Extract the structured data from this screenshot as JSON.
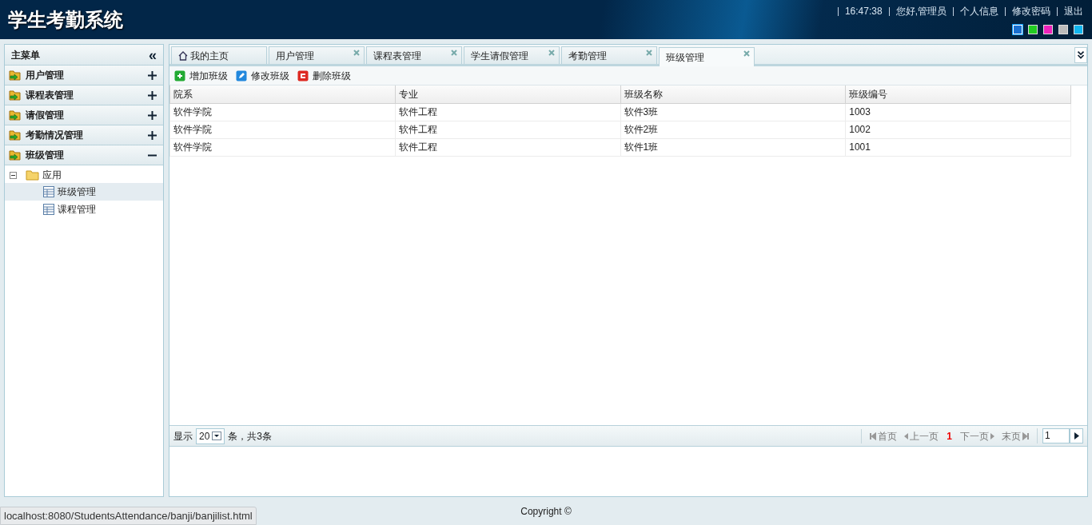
{
  "header": {
    "title": "学生考勤系统",
    "links": [
      "16:47:38",
      "您好,管理员",
      "个人信息",
      "修改密码",
      "退出"
    ],
    "themes": [
      {
        "color": "#1a6fd0",
        "selected": true
      },
      {
        "color": "#22cc22",
        "selected": false
      },
      {
        "color": "#ee22bb",
        "selected": false
      },
      {
        "color": "#bbbbbb",
        "selected": false
      },
      {
        "color": "#11b5ee",
        "selected": false
      }
    ]
  },
  "sidebar": {
    "title": "主菜单",
    "collapse": "«",
    "items": [
      {
        "label": "用户管理",
        "expanded": false
      },
      {
        "label": "课程表管理",
        "expanded": false
      },
      {
        "label": "请假管理",
        "expanded": false
      },
      {
        "label": "考勤情况管理",
        "expanded": false
      },
      {
        "label": "班级管理",
        "expanded": true,
        "tree": [
          {
            "label": "应用",
            "expanded": true,
            "children": [
              {
                "label": "班级管理",
                "selected": true
              },
              {
                "label": "课程管理",
                "selected": false
              }
            ]
          }
        ]
      }
    ]
  },
  "tabs": [
    {
      "label": "我的主页",
      "kind": "home",
      "selected": false
    },
    {
      "label": "用户管理",
      "kind": "closable",
      "selected": false
    },
    {
      "label": "课程表管理",
      "kind": "closable",
      "selected": false
    },
    {
      "label": "学生请假管理",
      "kind": "closable",
      "selected": false
    },
    {
      "label": "考勤管理",
      "kind": "closable",
      "selected": false
    },
    {
      "label": "班级管理",
      "kind": "closable",
      "selected": true
    }
  ],
  "toolbar": [
    {
      "label": "增加班级",
      "kind": "add"
    },
    {
      "label": "修改班级",
      "kind": "edit"
    },
    {
      "label": "删除班级",
      "kind": "delete"
    }
  ],
  "table": {
    "columns": [
      "院系",
      "专业",
      "班级名称",
      "班级编号"
    ],
    "rows": [
      [
        "软件学院",
        "软件工程",
        "软件3班",
        "1003"
      ],
      [
        "软件学院",
        "软件工程",
        "软件2班",
        "1002"
      ],
      [
        "软件学院",
        "软件工程",
        "软件1班",
        "1001"
      ]
    ]
  },
  "pager": {
    "show": "显示",
    "page_size": "20",
    "summary": "条，共3条",
    "first": "首页",
    "prev": "上一页",
    "current": "1",
    "next": "下一页",
    "last": "末页",
    "page_input": "1"
  },
  "footer": {
    "copyright": "Copyright ©",
    "status_url": "localhost:8080/StudentsAttendance/banji/banjilist.html"
  }
}
